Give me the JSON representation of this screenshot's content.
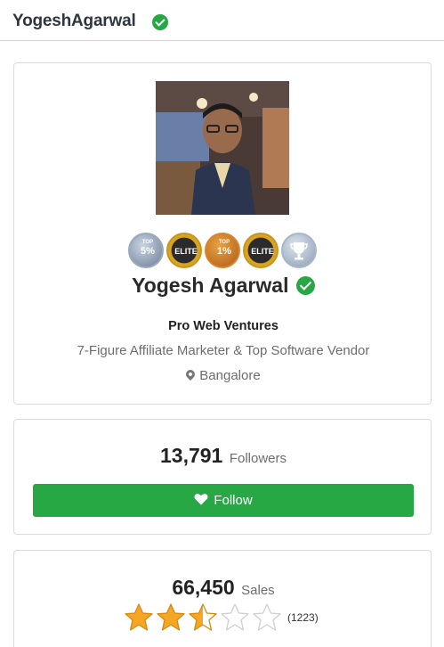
{
  "header": {
    "username": "YogeshAgarwal"
  },
  "profile": {
    "name": "Yogesh Agarwal",
    "company": "Pro Web Ventures",
    "tagline": "7-Figure Affiliate Marketer & Top Software Vendor",
    "location": "Bangalore",
    "badges": [
      {
        "icon": "top-5-percent-badge-icon",
        "label": "5%",
        "sub": "TOP"
      },
      {
        "icon": "elite-badge-icon",
        "label": "ELITE"
      },
      {
        "icon": "top-1-percent-badge-icon",
        "label": "1%",
        "sub": "TOP"
      },
      {
        "icon": "elite-badge-icon",
        "label": "ELITE"
      },
      {
        "icon": "trophy-badge-icon",
        "label": ""
      }
    ]
  },
  "followers": {
    "count": "13,791",
    "label": "Followers",
    "button_label": "Follow"
  },
  "sales": {
    "count": "66,450",
    "label": "Sales",
    "rating": 2.5,
    "rating_max": 5,
    "review_count": "(1223)"
  },
  "colors": {
    "verified": "#28a745",
    "follow_button": "#28a745",
    "star": "#f5a623",
    "star_empty": "#cfcfcf"
  }
}
